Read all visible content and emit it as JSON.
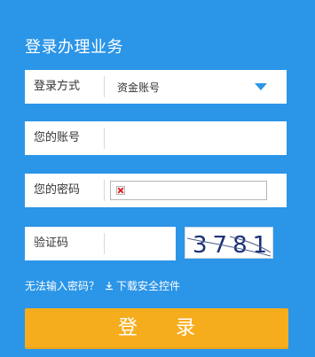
{
  "title": "登录办理业务",
  "login_method": {
    "label": "登录方式",
    "value": "资金账号"
  },
  "account": {
    "label": "您的账号"
  },
  "password": {
    "label": "您的密码"
  },
  "captcha": {
    "label": "验证码",
    "image_text": "3781"
  },
  "links": {
    "forgot": "无法输入密码？",
    "download": "下载安全控件"
  },
  "login_button": "登  录",
  "colors": {
    "background": "#2b95e8",
    "button": "#f6ad1d"
  },
  "icons": {
    "dropdown": "triangle-down-icon",
    "download": "download-icon",
    "broken_image": "broken-image-icon"
  }
}
